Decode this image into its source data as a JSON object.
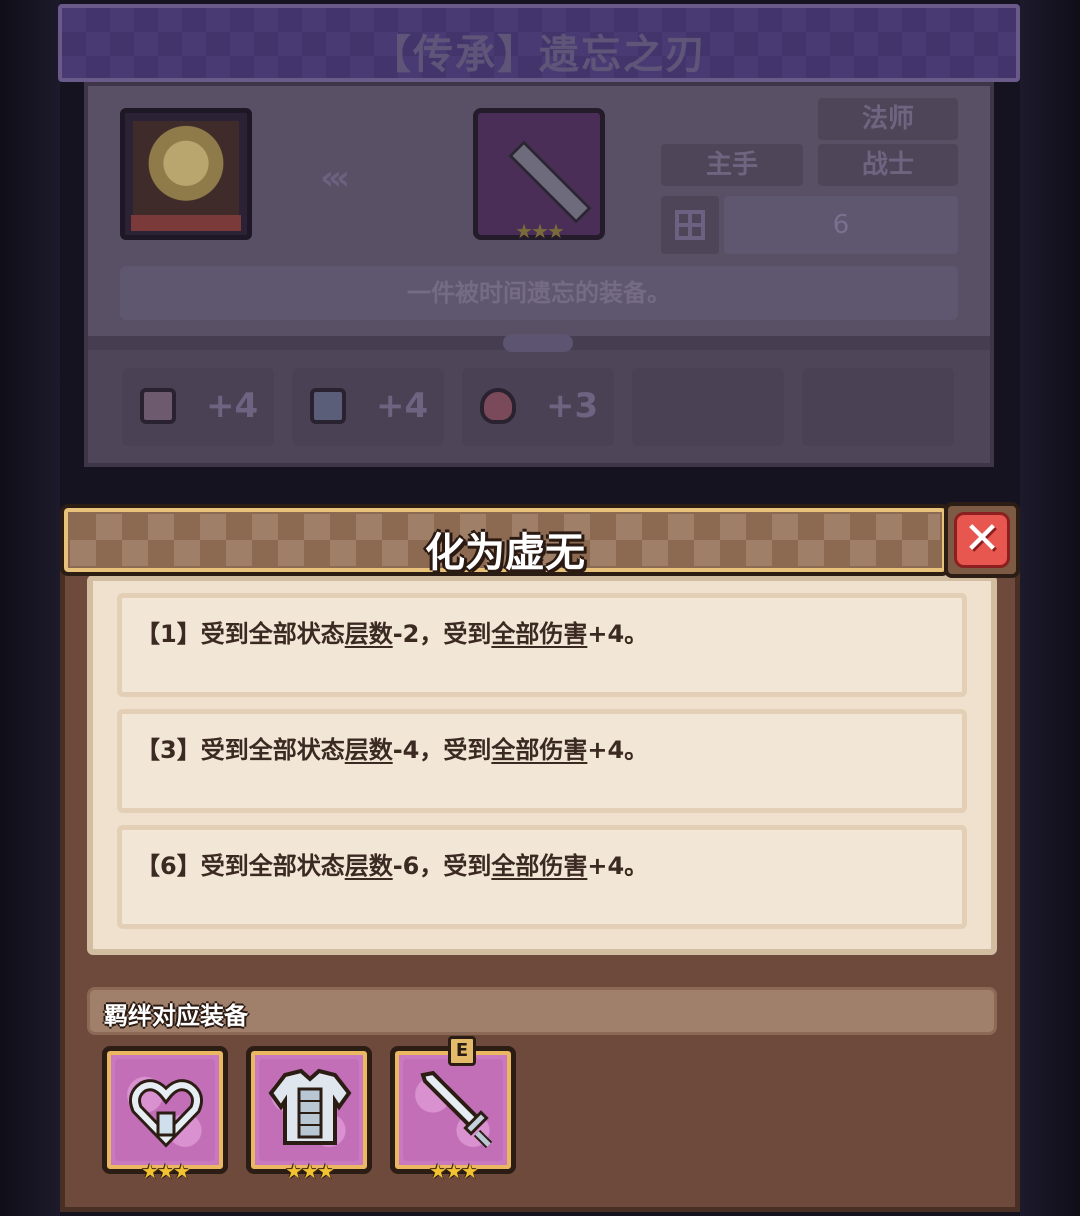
{
  "item": {
    "title": "【传承】遗忘之刃",
    "tags": {
      "class1": "法师",
      "slot": "主手",
      "class2": "战士"
    },
    "count": "6",
    "description": "一件被时间遗忘的装备。",
    "stats": [
      {
        "icon": "shield-icon",
        "value": "+4"
      },
      {
        "icon": "book-icon",
        "value": "+4"
      },
      {
        "icon": "heart-icon",
        "value": "+3"
      }
    ],
    "rarity_stars": "★★★"
  },
  "popup": {
    "title": "化为虚无",
    "close_label": "✕",
    "effects": [
      {
        "tier": "【1】",
        "p1": "受到全部状态",
        "u1": "层数",
        "p2": "-2，受到",
        "u2": "全部伤害",
        "p3": "+4。"
      },
      {
        "tier": "【3】",
        "p1": "受到全部状态",
        "u1": "层数",
        "p2": "-4，受到",
        "u2": "全部伤害",
        "p3": "+4。"
      },
      {
        "tier": "【6】",
        "p1": "受到全部状态",
        "u1": "层数",
        "p2": "-6，受到",
        "u2": "全部伤害",
        "p3": "+4。"
      }
    ],
    "bond_header": "羁绊对应装备",
    "equipment": [
      {
        "name": "heart-necklace-icon",
        "stars": "★★★"
      },
      {
        "name": "armor-icon",
        "stars": "★★★"
      },
      {
        "name": "sword-icon",
        "stars": "★★★",
        "badge": "E"
      }
    ]
  },
  "colors": {
    "popup_bg": "#6e4a3c",
    "panel_bg": "#efe1cd",
    "equip_bg": "#c979c0",
    "close_red": "#e85650",
    "star_gold": "#f3c232"
  }
}
